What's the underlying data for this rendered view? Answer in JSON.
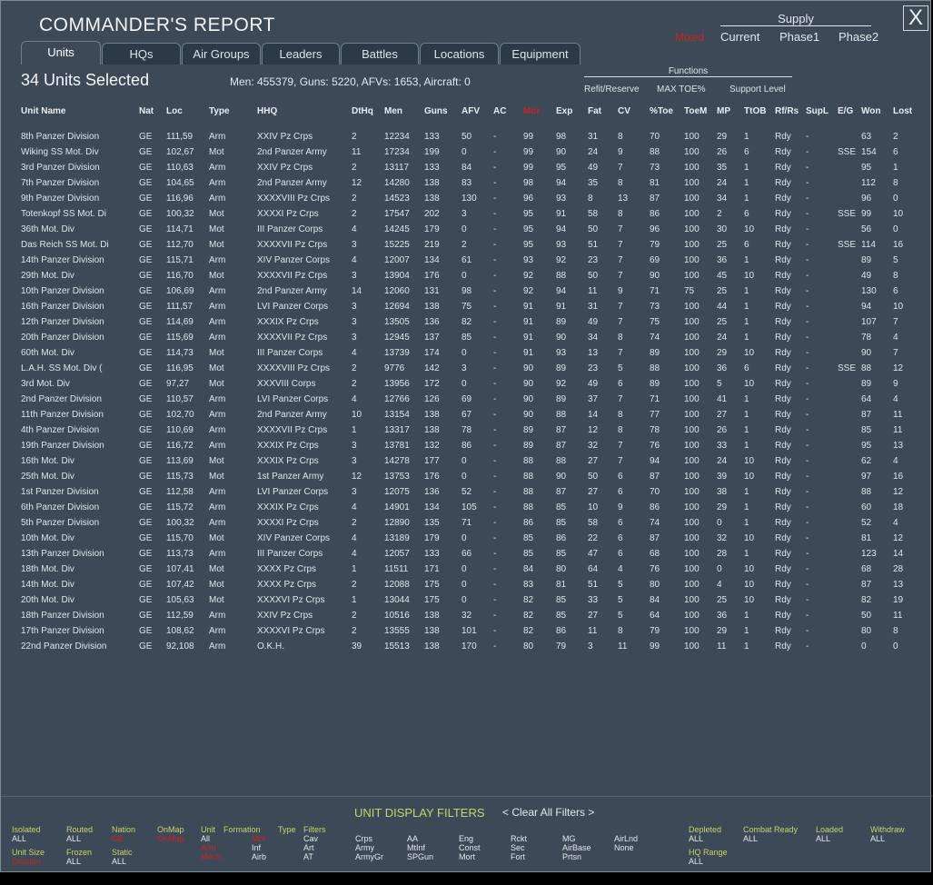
{
  "window": {
    "title": "COMMANDER'S REPORT",
    "close_glyph": "X"
  },
  "supply": {
    "title": "Supply",
    "mode_red": "Mixed",
    "options": [
      "Current",
      "Phase1",
      "Phase2"
    ]
  },
  "tabs": [
    "Units",
    "HQs",
    "Air Groups",
    "Leaders",
    "Battles",
    "Locations",
    "Equipment"
  ],
  "selection": {
    "label": "34 Units Selected",
    "totals": "Men: 455379, Guns: 5220, AFVs: 1653, Aircraft: 0"
  },
  "functions": {
    "title": "Functions",
    "options": [
      "Refit/Reserve",
      "MAX TOE%",
      "Support Level"
    ]
  },
  "table": {
    "columns": [
      "Unit Name",
      "Nat",
      "Loc",
      "Type",
      "HHQ",
      "DtHq",
      "Men",
      "Guns",
      "AFV",
      "AC",
      "Mor",
      "Exp",
      "Fat",
      "CV",
      "%Toe",
      "ToeM",
      "MP",
      "TtOB",
      "Rf/Rs",
      "SupL",
      "E/G",
      "Won",
      "Lost"
    ],
    "sorted_column_color": "#d02020",
    "rows": [
      [
        "8th Panzer Division",
        "GE",
        "111,59",
        "Arm",
        "XXIV Pz Crps",
        "2",
        "12234",
        "133",
        "50",
        "-",
        "99",
        "98",
        "31",
        "8",
        "70",
        "100",
        "29",
        "1",
        "Rdy",
        "-",
        "",
        "63",
        "2"
      ],
      [
        "Wiking SS Mot. Div",
        "GE",
        "102,67",
        "Mot",
        "2nd Panzer Army",
        "11",
        "17234",
        "199",
        "0",
        "-",
        "99",
        "90",
        "24",
        "9",
        "88",
        "100",
        "26",
        "6",
        "Rdy",
        "-",
        "SSE",
        "154",
        "6"
      ],
      [
        "3rd Panzer Division",
        "GE",
        "110,63",
        "Arm",
        "XXIV Pz Crps",
        "2",
        "13117",
        "133",
        "84",
        "-",
        "99",
        "95",
        "49",
        "7",
        "73",
        "100",
        "35",
        "1",
        "Rdy",
        "-",
        "",
        "95",
        "1"
      ],
      [
        "7th Panzer Division",
        "GE",
        "104,65",
        "Arm",
        "2nd Panzer Army",
        "12",
        "14280",
        "138",
        "83",
        "-",
        "98",
        "94",
        "35",
        "8",
        "81",
        "100",
        "24",
        "1",
        "Rdy",
        "-",
        "",
        "112",
        "8"
      ],
      [
        "9th Panzer Division",
        "GE",
        "116,96",
        "Arm",
        "XXXXVIII Pz Crps",
        "2",
        "14523",
        "138",
        "130",
        "-",
        "96",
        "93",
        "8",
        "13",
        "87",
        "100",
        "34",
        "1",
        "Rdy",
        "-",
        "",
        "96",
        "0"
      ],
      [
        "Totenkopf SS Mot. Di",
        "GE",
        "100,32",
        "Mot",
        "XXXXI Pz Crps",
        "2",
        "17547",
        "202",
        "3",
        "-",
        "95",
        "91",
        "58",
        "8",
        "86",
        "100",
        "2",
        "6",
        "Rdy",
        "-",
        "SSE",
        "99",
        "10"
      ],
      [
        "36th Mot. Div",
        "GE",
        "114,71",
        "Mot",
        "III Panzer Corps",
        "4",
        "14245",
        "179",
        "0",
        "-",
        "95",
        "94",
        "50",
        "7",
        "96",
        "100",
        "30",
        "10",
        "Rdy",
        "-",
        "",
        "56",
        "0"
      ],
      [
        "Das Reich SS Mot. Di",
        "GE",
        "112,70",
        "Mot",
        "XXXXVII Pz Crps",
        "3",
        "15225",
        "219",
        "2",
        "-",
        "95",
        "93",
        "51",
        "7",
        "79",
        "100",
        "25",
        "6",
        "Rdy",
        "-",
        "SSE",
        "114",
        "16"
      ],
      [
        "14th Panzer Division",
        "GE",
        "115,71",
        "Arm",
        "XIV Panzer Corps",
        "4",
        "12007",
        "134",
        "61",
        "-",
        "93",
        "92",
        "23",
        "7",
        "69",
        "100",
        "36",
        "1",
        "Rdy",
        "-",
        "",
        "89",
        "5"
      ],
      [
        "29th Mot. Div",
        "GE",
        "116,70",
        "Mot",
        "XXXXVII Pz Crps",
        "3",
        "13904",
        "176",
        "0",
        "-",
        "92",
        "88",
        "50",
        "7",
        "90",
        "100",
        "45",
        "10",
        "Rdy",
        "-",
        "",
        "49",
        "8"
      ],
      [
        "10th Panzer Division",
        "GE",
        "106,69",
        "Arm",
        "2nd Panzer Army",
        "14",
        "12060",
        "131",
        "98",
        "-",
        "92",
        "94",
        "11",
        "9",
        "71",
        "75",
        "25",
        "1",
        "Rdy",
        "-",
        "",
        "130",
        "6"
      ],
      [
        "16th Panzer Division",
        "GE",
        "111,57",
        "Arm",
        "LVI Panzer Corps",
        "3",
        "12694",
        "138",
        "75",
        "-",
        "91",
        "91",
        "31",
        "7",
        "73",
        "100",
        "44",
        "1",
        "Rdy",
        "-",
        "",
        "94",
        "10"
      ],
      [
        "12th Panzer Division",
        "GE",
        "114,69",
        "Arm",
        "XXXIX Pz Crps",
        "3",
        "13505",
        "136",
        "82",
        "-",
        "91",
        "89",
        "49",
        "7",
        "75",
        "100",
        "25",
        "1",
        "Rdy",
        "-",
        "",
        "107",
        "7"
      ],
      [
        "20th Panzer Division",
        "GE",
        "115,69",
        "Arm",
        "XXXXVII Pz Crps",
        "3",
        "12945",
        "137",
        "85",
        "-",
        "91",
        "90",
        "34",
        "8",
        "74",
        "100",
        "24",
        "1",
        "Rdy",
        "-",
        "",
        "78",
        "4"
      ],
      [
        "60th Mot. Div",
        "GE",
        "114,73",
        "Mot",
        "III Panzer Corps",
        "4",
        "13739",
        "174",
        "0",
        "-",
        "91",
        "93",
        "13",
        "7",
        "89",
        "100",
        "29",
        "10",
        "Rdy",
        "-",
        "",
        "90",
        "7"
      ],
      [
        "L.A.H. SS Mot. Div (",
        "GE",
        "116,95",
        "Mot",
        "XXXXVIII Pz Crps",
        "2",
        "9776",
        "142",
        "3",
        "-",
        "90",
        "89",
        "23",
        "5",
        "88",
        "100",
        "36",
        "6",
        "Rdy",
        "-",
        "SSE",
        "88",
        "12"
      ],
      [
        "3rd Mot. Div",
        "GE",
        "97,27",
        "Mot",
        "XXXVIII Corps",
        "2",
        "13956",
        "172",
        "0",
        "-",
        "90",
        "92",
        "49",
        "6",
        "89",
        "100",
        "5",
        "10",
        "Rdy",
        "-",
        "",
        "89",
        "9"
      ],
      [
        "2nd Panzer Division",
        "GE",
        "110,57",
        "Arm",
        "LVI Panzer Corps",
        "4",
        "12766",
        "126",
        "69",
        "-",
        "90",
        "89",
        "37",
        "7",
        "71",
        "100",
        "41",
        "1",
        "Rdy",
        "-",
        "",
        "64",
        "4"
      ],
      [
        "11th Panzer Division",
        "GE",
        "102,70",
        "Arm",
        "2nd Panzer Army",
        "10",
        "13154",
        "138",
        "67",
        "-",
        "90",
        "88",
        "14",
        "8",
        "77",
        "100",
        "27",
        "1",
        "Rdy",
        "-",
        "",
        "87",
        "11"
      ],
      [
        "4th Panzer Division",
        "GE",
        "110,69",
        "Arm",
        "XXXXVII Pz Crps",
        "1",
        "13317",
        "138",
        "78",
        "-",
        "89",
        "87",
        "12",
        "8",
        "78",
        "100",
        "26",
        "1",
        "Rdy",
        "-",
        "",
        "85",
        "11"
      ],
      [
        "19th Panzer Division",
        "GE",
        "116,72",
        "Arm",
        "XXXIX Pz Crps",
        "3",
        "13781",
        "132",
        "86",
        "-",
        "89",
        "87",
        "32",
        "7",
        "76",
        "100",
        "33",
        "1",
        "Rdy",
        "-",
        "",
        "95",
        "13"
      ],
      [
        "16th Mot. Div",
        "GE",
        "113,69",
        "Mot",
        "XXXIX Pz Crps",
        "3",
        "14278",
        "177",
        "0",
        "-",
        "88",
        "88",
        "27",
        "7",
        "94",
        "100",
        "24",
        "10",
        "Rdy",
        "-",
        "",
        "62",
        "4"
      ],
      [
        "25th Mot. Div",
        "GE",
        "115,73",
        "Mot",
        "1st Panzer Army",
        "12",
        "13753",
        "176",
        "0",
        "-",
        "88",
        "90",
        "50",
        "6",
        "87",
        "100",
        "39",
        "10",
        "Rdy",
        "-",
        "",
        "97",
        "16"
      ],
      [
        "1st Panzer Division",
        "GE",
        "112,58",
        "Arm",
        "LVI Panzer Corps",
        "3",
        "12075",
        "136",
        "52",
        "-",
        "88",
        "87",
        "27",
        "6",
        "70",
        "100",
        "38",
        "1",
        "Rdy",
        "-",
        "",
        "88",
        "12"
      ],
      [
        "6th Panzer Division",
        "GE",
        "115,72",
        "Arm",
        "XXXIX Pz Crps",
        "4",
        "14901",
        "134",
        "105",
        "-",
        "88",
        "85",
        "10",
        "9",
        "86",
        "100",
        "29",
        "1",
        "Rdy",
        "-",
        "",
        "60",
        "18"
      ],
      [
        "5th Panzer Division",
        "GE",
        "100,32",
        "Arm",
        "XXXXI Pz Crps",
        "2",
        "12890",
        "135",
        "71",
        "-",
        "86",
        "85",
        "58",
        "6",
        "74",
        "100",
        "0",
        "1",
        "Rdy",
        "-",
        "",
        "52",
        "4"
      ],
      [
        "10th Mot. Div",
        "GE",
        "115,70",
        "Mot",
        "XIV Panzer Corps",
        "4",
        "13189",
        "179",
        "0",
        "-",
        "85",
        "86",
        "22",
        "6",
        "87",
        "100",
        "32",
        "10",
        "Rdy",
        "-",
        "",
        "81",
        "12"
      ],
      [
        "13th Panzer Division",
        "GE",
        "113,73",
        "Arm",
        "III Panzer Corps",
        "4",
        "12057",
        "133",
        "66",
        "-",
        "85",
        "85",
        "47",
        "6",
        "68",
        "100",
        "28",
        "1",
        "Rdy",
        "-",
        "",
        "123",
        "14"
      ],
      [
        "18th Mot. Div",
        "GE",
        "107,41",
        "Mot",
        "XXXX Pz Crps",
        "1",
        "11511",
        "171",
        "0",
        "-",
        "84",
        "80",
        "64",
        "4",
        "76",
        "100",
        "0",
        "10",
        "Rdy",
        "-",
        "",
        "68",
        "28"
      ],
      [
        "14th Mot. Div",
        "GE",
        "107,42",
        "Mot",
        "XXXX Pz Crps",
        "2",
        "12088",
        "175",
        "0",
        "-",
        "83",
        "81",
        "51",
        "5",
        "80",
        "100",
        "4",
        "10",
        "Rdy",
        "-",
        "",
        "87",
        "13"
      ],
      [
        "20th Mot. Div",
        "GE",
        "105,63",
        "Mot",
        "XXXXVI Pz Crps",
        "1",
        "13044",
        "175",
        "0",
        "-",
        "82",
        "85",
        "33",
        "5",
        "84",
        "100",
        "25",
        "10",
        "Rdy",
        "-",
        "",
        "82",
        "19"
      ],
      [
        "18th Panzer Division",
        "GE",
        "112,59",
        "Arm",
        "XXIV Pz Crps",
        "2",
        "10516",
        "138",
        "32",
        "-",
        "82",
        "85",
        "27",
        "5",
        "64",
        "100",
        "36",
        "1",
        "Rdy",
        "-",
        "",
        "50",
        "11"
      ],
      [
        "17th Panzer Division",
        "GE",
        "108,62",
        "Arm",
        "XXXXVI Pz Crps",
        "2",
        "13555",
        "138",
        "101",
        "-",
        "82",
        "86",
        "11",
        "8",
        "79",
        "100",
        "29",
        "1",
        "Rdy",
        "-",
        "",
        "80",
        "8"
      ],
      [
        "22nd Panzer Division",
        "GE",
        "92,108",
        "Arm",
        "O.K.H.",
        "39",
        "15513",
        "138",
        "170",
        "-",
        "80",
        "79",
        "3",
        "11",
        "99",
        "100",
        "11",
        "1",
        "Rdy",
        "-",
        "",
        "0",
        "0"
      ]
    ]
  },
  "filters": {
    "title": "UNIT DISPLAY FILTERS",
    "clear": "< Clear All Filters >",
    "labels": {
      "isolated": "Isolated",
      "routed": "Routed",
      "nation": "Nation",
      "onmap": "OnMap",
      "unit": "Unit",
      "formation": "Formation",
      "type": "Type",
      "filters": "Filters",
      "unit_size": "Unit Size",
      "frozen": "Frozen",
      "static": "Static",
      "depleted": "Depleted",
      "combat_ready": "Combat Ready",
      "loaded": "Loaded",
      "withdraw": "Withdraw",
      "hq_range": "HQ Range"
    },
    "values": {
      "isolated": "ALL",
      "routed": "ALL",
      "nation": "GE",
      "onmap": "OnMap",
      "unit": "All",
      "formation_1": "Inf",
      "formation_2": "Airb",
      "formation_red_1": "Mot",
      "formation_red_2": "Arm",
      "formation_red_3": "Mech",
      "unit_size": "Division",
      "frozen": "ALL",
      "static": "ALL",
      "type_col1": [
        "Cav",
        "Art",
        "AT"
      ],
      "type_col2": [
        "Crps",
        "Army",
        "ArmyGr"
      ],
      "type_col3": [
        "AA",
        "MtInf",
        "SPGun"
      ],
      "type_col4": [
        "Eng",
        "Const",
        "Mort"
      ],
      "type_col5": [
        "Rckt",
        "Sec",
        "Fort"
      ],
      "type_col6": [
        "MG",
        "AirBase",
        "Prtsn"
      ],
      "type_col7": [
        "AirLnd",
        "None"
      ],
      "depleted": "ALL",
      "combat_ready": "ALL",
      "loaded": "ALL",
      "withdraw": "ALL",
      "hq_range": "ALL"
    }
  }
}
